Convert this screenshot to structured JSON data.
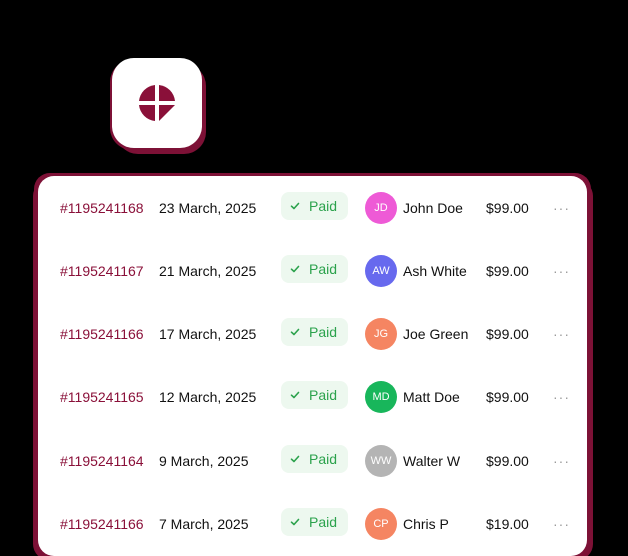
{
  "app": {
    "icon": "pie-chart-logo-icon",
    "accent_color": "#8a1039"
  },
  "invoices": {
    "status_colors": {
      "paid_text": "#2ba24c",
      "paid_bg": "#edf8ef"
    },
    "rows": [
      {
        "id": "#1195241168",
        "date": "23 March, 2025",
        "status": "Paid",
        "initials": "JD",
        "name": "John Doe",
        "avatar_color": "#ee5ad6",
        "amount": "$99.00",
        "more": "···"
      },
      {
        "id": "#1195241167",
        "date": "21 March, 2025",
        "status": "Paid",
        "initials": "AW",
        "name": "Ash White",
        "avatar_color": "#6769ee",
        "amount": "$99.00",
        "more": "···"
      },
      {
        "id": "#1195241166",
        "date": "17 March, 2025",
        "status": "Paid",
        "initials": "JG",
        "name": "Joe Green",
        "avatar_color": "#f58562",
        "amount": "$99.00",
        "more": "···"
      },
      {
        "id": "#1195241165",
        "date": "12 March, 2025",
        "status": "Paid",
        "initials": "MD",
        "name": "Matt Doe",
        "avatar_color": "#18b65b",
        "amount": "$99.00",
        "more": "···"
      },
      {
        "id": "#1195241164",
        "date": "9 March, 2025",
        "status": "Paid",
        "initials": "WW",
        "name": "Walter W",
        "avatar_color": "#b4b4b4",
        "amount": "$99.00",
        "more": "···"
      },
      {
        "id": "#1195241166",
        "date": "7 March, 2025",
        "status": "Paid",
        "initials": "CP",
        "name": "Chris P",
        "avatar_color": "#f58562",
        "amount": "$19.00",
        "more": "···"
      }
    ]
  }
}
